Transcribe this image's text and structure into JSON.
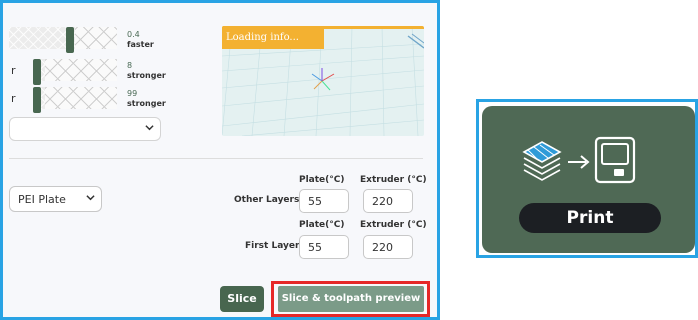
{
  "sliders": [
    {
      "left_text": "",
      "value": "0.4",
      "desc": "faster"
    },
    {
      "left_text": "r",
      "value": "8",
      "desc": "stronger"
    },
    {
      "left_text": "r",
      "value": "99",
      "desc": "stronger"
    }
  ],
  "select_dropdown": {
    "value": "",
    "icon": "chevron-down-icon"
  },
  "preview": {
    "loading_text": "Loading info...",
    "accent_color": "#f3b131"
  },
  "plate": {
    "selected": "PEI Plate",
    "icon": "chevron-down-icon"
  },
  "temperatures": {
    "col_plate": "Plate(°C)",
    "col_extruder": "Extruder (°C)",
    "other_layers": {
      "label": "Other Layers",
      "plate": "55",
      "extruder": "220"
    },
    "first_layer": {
      "label": "First Layer",
      "plate": "55",
      "extruder": "220"
    }
  },
  "actions": {
    "slice_label": "Slice",
    "slice_preview_label": "Slice & toolpath preview",
    "primary_color": "#48664f",
    "highlight_color": "#e62828"
  },
  "print_card": {
    "label": "Print",
    "icons": [
      "layers-icon",
      "arrow-right-icon",
      "printer-icon"
    ],
    "bg_color": "#4f6955"
  },
  "frame_color": "#29a3e4"
}
